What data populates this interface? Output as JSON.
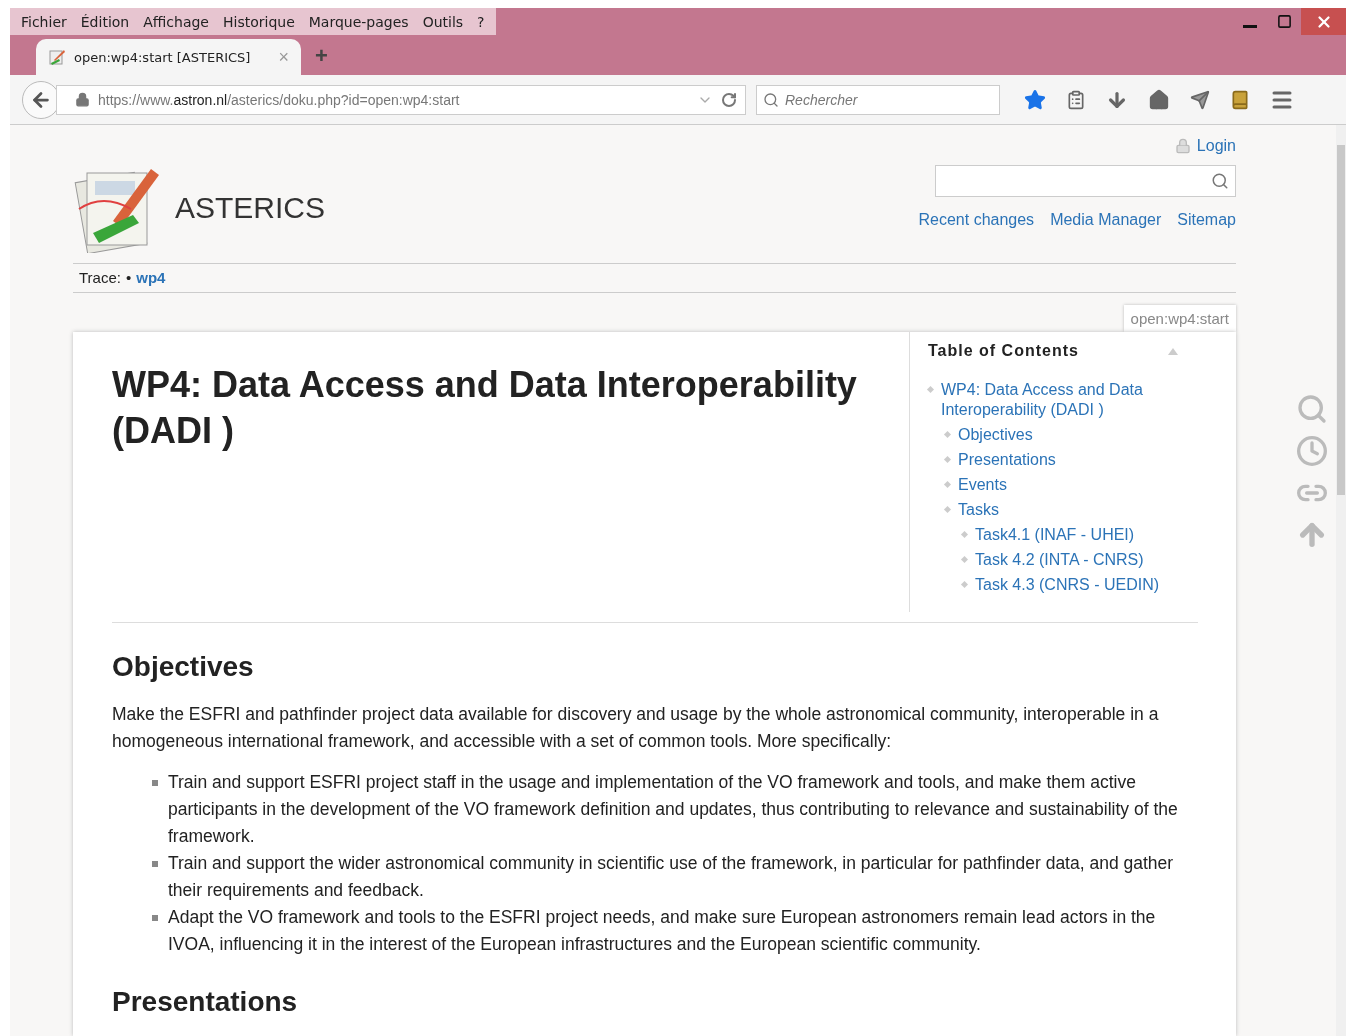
{
  "menu": [
    "Fichier",
    "Édition",
    "Affichage",
    "Historique",
    "Marque-pages",
    "Outils",
    "?"
  ],
  "tab": {
    "title": "open:wp4:start [ASTERICS]",
    "close": "×",
    "new": "+"
  },
  "address": {
    "url": "https://www.**astron.nl**/asterics/doku.php?id=open:wp4:start"
  },
  "search": {
    "placeholder": "Rechercher"
  },
  "site": {
    "title": "ASTERICS",
    "login": "Login",
    "links": [
      "Recent changes",
      "Media Manager",
      "Sitemap"
    ]
  },
  "trace": {
    "label": "Trace:",
    "separator": "•",
    "items": [
      "wp4"
    ]
  },
  "page_id": "open:wp4:start",
  "toc": {
    "title": "Table of Contents",
    "items": [
      {
        "label": "WP4: Data Access and Data Interoperability (DADI )",
        "children": [
          {
            "label": "Objectives"
          },
          {
            "label": "Presentations"
          },
          {
            "label": "Events"
          },
          {
            "label": "Tasks",
            "children": [
              {
                "label": "Task4.1 (INAF - UHEI)"
              },
              {
                "label": "Task 4.2 (INTA - CNRS)"
              },
              {
                "label": "Task 4.3 (CNRS - UEDIN)"
              }
            ]
          }
        ]
      }
    ]
  },
  "content": {
    "title": "WP4: Data Access and Data Interoperability (DADI )",
    "sections": [
      {
        "heading": "Objectives",
        "paragraph": "Make the ESFRI and pathfinder project data available for discovery and usage by the whole astronomical community, interoperable in a homogeneous international framework, and accessible with a set of common tools. More specifically:",
        "bullets": [
          "Train and support ESFRI project staff in the usage and implementation of the VO framework and tools, and make them active participants in the development of the VO framework definition and updates, thus contributing to relevance and sustainability of the framework.",
          "Train and support the wider astronomical community in scientific use of the framework, in particular for pathfinder data, and gather their requirements and feedback.",
          "Adapt the VO framework and tools to the ESFRI project needs, and make sure European astronomers remain lead actors in the IVOA, influencing it in the interest of the European infrastructures and the European scientific community."
        ]
      },
      {
        "heading": "Presentations"
      }
    ]
  }
}
